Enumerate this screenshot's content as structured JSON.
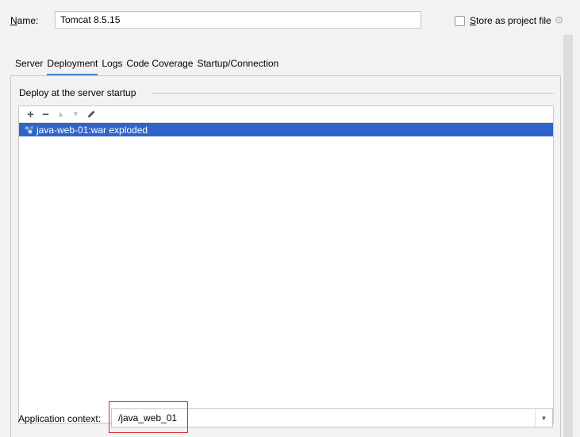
{
  "name_label_mnemonic": "N",
  "name_label_rest": "ame:",
  "name_value": "Tomcat 8.5.15",
  "store_mnemonic": "S",
  "store_rest": "tore as project file",
  "tabs": [
    {
      "label": "Server"
    },
    {
      "label": "Deployment",
      "active": true
    },
    {
      "label": "Logs"
    },
    {
      "label": "Code Coverage"
    },
    {
      "label": "Startup/Connection"
    }
  ],
  "deploy_group_title": "Deploy at the server startup",
  "toolbar": {
    "add_icon": "plus-icon",
    "remove_icon": "minus-icon",
    "up_icon": "move-up-icon",
    "down_icon": "move-down-icon",
    "edit_icon": "pencil-icon"
  },
  "artifacts": [
    "java-web-01:war exploded"
  ],
  "application_context_label": "Application context:",
  "application_context_value": "/java_web_01",
  "colors": {
    "selection": "#2f65ca",
    "active_tab_underline": "#4083c9",
    "highlight": "#d42a2a"
  }
}
